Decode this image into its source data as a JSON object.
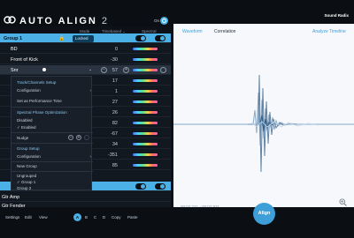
{
  "header": {
    "brand": "Sound Radix",
    "product": "AUTO ALIGN",
    "version": "2",
    "on_label": "On",
    "cols": {
      "mode": "Mode",
      "timbre": "Timbre",
      "spectral": "Spectral"
    },
    "mode_value": "Timebased",
    "mode_chevron": "chevron-down-icon"
  },
  "group1": {
    "name": "Group 1",
    "mode": "Locked"
  },
  "tracks": [
    {
      "name": "BD",
      "value": "0"
    },
    {
      "name": "Front of Kick",
      "value": "-30"
    },
    {
      "name": "Snr",
      "value": "57"
    },
    {
      "name": "",
      "value": "17"
    },
    {
      "name": "",
      "value": "1"
    },
    {
      "name": "",
      "value": "27"
    },
    {
      "name": "",
      "value": "26"
    },
    {
      "name": "",
      "value": "82"
    },
    {
      "name": "",
      "value": "-67"
    },
    {
      "name": "",
      "value": "34"
    },
    {
      "name": "",
      "value": "-351"
    },
    {
      "name": "",
      "value": "85"
    }
  ],
  "group2_tracks": [
    {
      "name": "Gtr Amp",
      "value": ""
    },
    {
      "name": "Gtr Fender",
      "value": ""
    }
  ],
  "menu": {
    "track_setup": "Track/Channels Setup",
    "configuration": "Configuration",
    "set_perf": "Set as Performance Time",
    "spo": "Spectral Phase Optimization",
    "disabled": "Disabled",
    "enabled": "✓ Enabled",
    "nudge": "Nudge",
    "group_setup": "Group Setup",
    "configuration2": "Configuration",
    "new_group": "New Group",
    "ungrouped": "Ungrouped",
    "group1": "✓ Group 1",
    "group2": "Group 2"
  },
  "right": {
    "tabs": [
      "Waveform",
      "Correlation",
      "Analyze Timeline"
    ],
    "timestamp": "00:07.721 - 00:07.821",
    "align": "Align"
  },
  "toolbar": {
    "settings": "Settings",
    "edit": "Edit",
    "view": "View",
    "slots": [
      "A",
      "B",
      "C",
      "D"
    ],
    "copy": "Copy",
    "paste": "Paste"
  }
}
